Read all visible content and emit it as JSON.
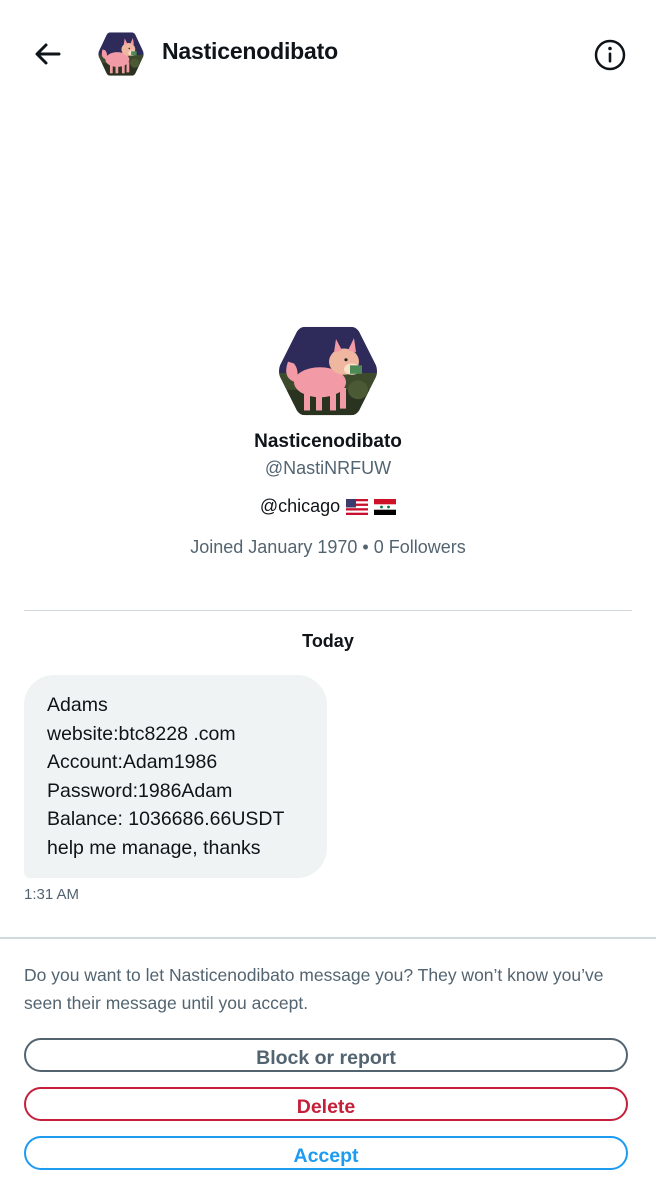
{
  "header": {
    "title": "Nasticenodibato",
    "back_icon": "arrow-left-icon",
    "info_icon": "info-icon"
  },
  "profile": {
    "display_name": "Nasticenodibato",
    "handle": "@NastiNRFUW",
    "bio": "@chicago",
    "bio_flags": [
      "flag-us-icon",
      "flag-syria-icon"
    ],
    "joined": "Joined January 1970",
    "separator": "•",
    "followers": "0 Followers"
  },
  "conversation": {
    "date_label": "Today",
    "message": {
      "lines": [
        "Adams",
        "website:btc8228 .com",
        "Account:Adam1986",
        "Password:1986Adam",
        "Balance: 1036686.66USDT",
        "help me manage, thanks"
      ],
      "time": "1:31 AM"
    }
  },
  "request": {
    "prompt": "Do you want to let Nasticenodibato message you? They won’t know you’ve seen their message until you accept.",
    "block_label": "Block or report",
    "delete_label": "Delete",
    "accept_label": "Accept"
  },
  "colors": {
    "text_primary": "#0f1419",
    "text_secondary": "#536471",
    "bubble_bg": "#eff3f4",
    "danger": "#c4203a",
    "accent": "#1d9bf0",
    "divider": "#cfd9de"
  }
}
